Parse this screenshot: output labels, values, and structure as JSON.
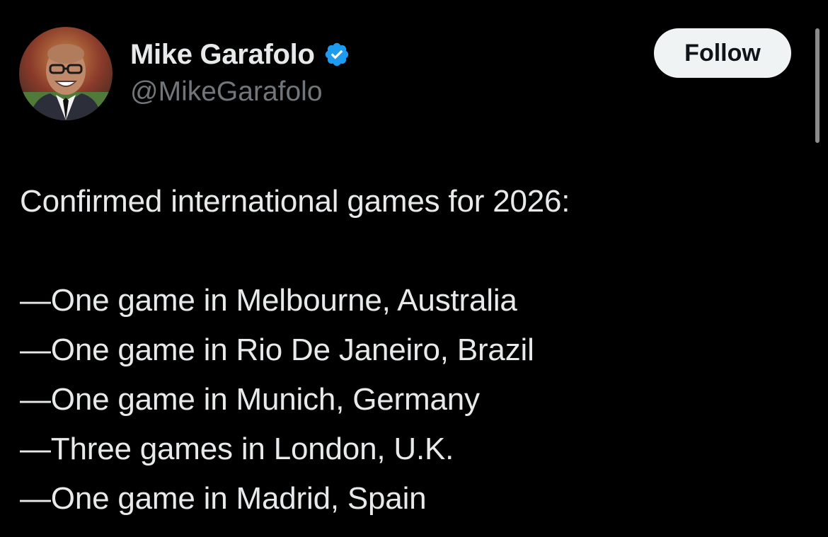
{
  "author": {
    "display_name": "Mike Garafolo",
    "handle": "@MikeGarafolo",
    "verified": true,
    "verified_color": "#1d9bf0",
    "avatar_icon": "profile-photo"
  },
  "follow_button": {
    "label": "Follow"
  },
  "tweet": {
    "intro": "Confirmed international games for 2026:",
    "items": [
      "—One game in Melbourne, Australia",
      "—One game in Rio De Janeiro, Brazil",
      "—One game in Munich, Germany",
      "—Three games in London, U.K.",
      "—One game in Madrid, Spain"
    ]
  },
  "colors": {
    "background": "#000000",
    "text_primary": "#e7e9ea",
    "text_secondary": "#71767b",
    "button_bg": "#eff3f4",
    "button_text": "#0f1419"
  }
}
